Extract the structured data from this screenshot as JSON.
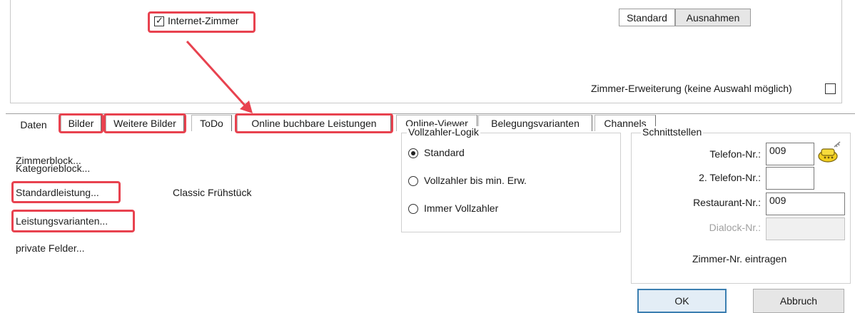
{
  "top": {
    "internet_zimmer_label": "Internet-Zimmer",
    "standard_label": "Standard",
    "ausnahmen_label": "Ausnahmen",
    "zimmer_erweiterung_label": "Zimmer-Erweiterung (keine Auswahl möglich)"
  },
  "tabs": [
    {
      "label": "Daten"
    },
    {
      "label": "Bilder"
    },
    {
      "label": "Weitere Bilder"
    },
    {
      "label": "ToDo"
    },
    {
      "label": "Online buchbare Leistungen"
    },
    {
      "label": "Online-Viewer"
    },
    {
      "label": "Belegungsvarianten"
    },
    {
      "label": "Channels"
    }
  ],
  "left": {
    "zimmerblock": "Zimmerblock...",
    "kategorieblock": "Kategorieblock...",
    "standardleistung": "Standardleistung...",
    "standardleistung_value": "Classic  Frühstück",
    "leistungsvarianten": "Leistungsvarianten...",
    "private_felder": "private Felder..."
  },
  "vollzahler": {
    "title": "Vollzahler-Logik",
    "options": [
      {
        "label": "Standard",
        "selected": true
      },
      {
        "label": "Vollzahler bis min. Erw.",
        "selected": false
      },
      {
        "label": "Immer Vollzahler",
        "selected": false
      }
    ]
  },
  "schnittstellen": {
    "title": "Schnittstellen",
    "telefon_label": "Telefon-Nr.:",
    "telefon_value": "009",
    "telefon2_label": "2. Telefon-Nr.:",
    "telefon2_value": "",
    "restaurant_label": "Restaurant-Nr.:",
    "restaurant_value": "009",
    "dialock_label": "Dialock-Nr.:",
    "dialock_value": "",
    "zimmer_nr_label": "Zimmer-Nr. eintragen"
  },
  "buttons": {
    "ok_label": "OK",
    "abbruch_label": "Abbruch"
  },
  "colors": {
    "highlight": "#e8424f",
    "ok_border": "#3c7fb1"
  },
  "icons": [
    "phone-key-icon",
    "checkbox-checked-icon",
    "annotation-arrow"
  ]
}
